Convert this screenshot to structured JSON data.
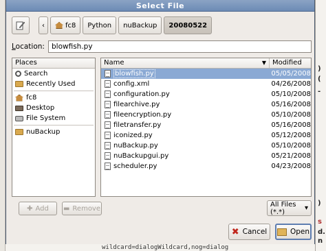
{
  "dialog": {
    "title": "Select File"
  },
  "pathbar": {
    "crumbs": [
      "fc8",
      "Python",
      "nuBackup",
      "20080522"
    ]
  },
  "location": {
    "label": "Location:",
    "label_u": "L",
    "label_rest": "ocation:",
    "value": "blowfish.py"
  },
  "places": {
    "header": "Places",
    "items": [
      {
        "label": "Search",
        "icon": "search-icon"
      },
      {
        "label": "Recently Used",
        "icon": "folder-icon"
      },
      {
        "label": "fc8",
        "icon": "home-icon"
      },
      {
        "label": "Desktop",
        "icon": "desktop-icon"
      },
      {
        "label": "File System",
        "icon": "disk-icon"
      },
      {
        "label": "nuBackup",
        "icon": "folder-icon"
      }
    ]
  },
  "files": {
    "col_name": "Name",
    "col_modified": "Modified",
    "rows": [
      {
        "name": "blowfish.py",
        "modified": "05/05/2008"
      },
      {
        "name": "config.xml",
        "modified": "04/26/2008"
      },
      {
        "name": "configuration.py",
        "modified": "05/10/2008"
      },
      {
        "name": "filearchive.py",
        "modified": "05/16/2008"
      },
      {
        "name": "fileencryption.py",
        "modified": "05/10/2008"
      },
      {
        "name": "filetransfer.py",
        "modified": "05/16/2008"
      },
      {
        "name": "iconized.py",
        "modified": "05/12/2008"
      },
      {
        "name": "nuBackup.py",
        "modified": "05/10/2008"
      },
      {
        "name": "nuBackupgui.py",
        "modified": "05/21/2008"
      },
      {
        "name": "scheduler.py",
        "modified": "04/23/2008"
      }
    ]
  },
  "buttons": {
    "add": "Add",
    "remove": "Remove",
    "filter": "All Files (*.*)",
    "cancel": "Cancel",
    "open": "Open"
  },
  "background": {
    "right_marks": [
      ")",
      "(",
      "-",
      ")",
      "s",
      "d.",
      "n"
    ],
    "bottom_text": "wildcard=dialogWildcard,nog=dialog"
  }
}
